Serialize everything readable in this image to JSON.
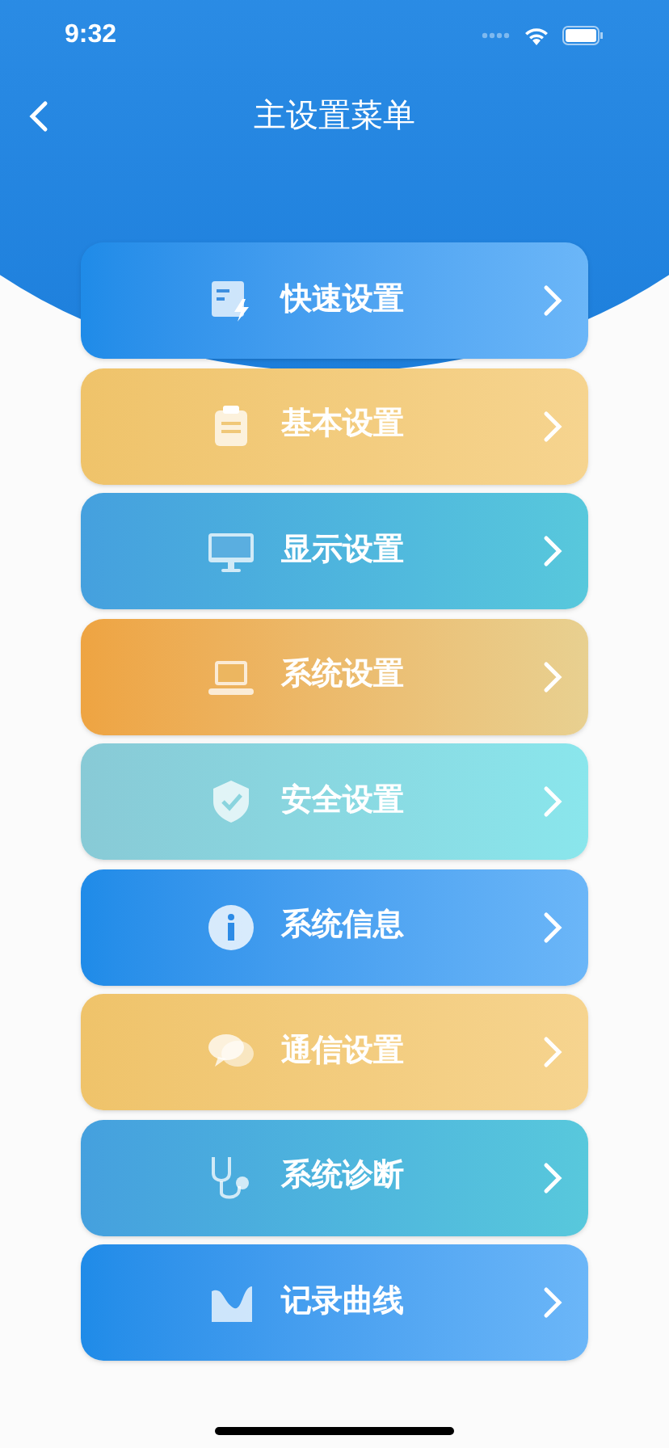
{
  "status_bar": {
    "time": "9:32"
  },
  "nav": {
    "title": "主设置菜单"
  },
  "menu": [
    {
      "label": "快速设置",
      "kind": "quick"
    },
    {
      "label": "基本设置",
      "kind": "clipboard"
    },
    {
      "label": "显示设置",
      "kind": "monitor"
    },
    {
      "label": "系统设置",
      "kind": "laptop"
    },
    {
      "label": "安全设置",
      "kind": "shield"
    },
    {
      "label": "系统信息",
      "kind": "info"
    },
    {
      "label": "通信设置",
      "kind": "chat"
    },
    {
      "label": "系统诊断",
      "kind": "stethoscope"
    },
    {
      "label": "记录曲线",
      "kind": "chart"
    }
  ]
}
